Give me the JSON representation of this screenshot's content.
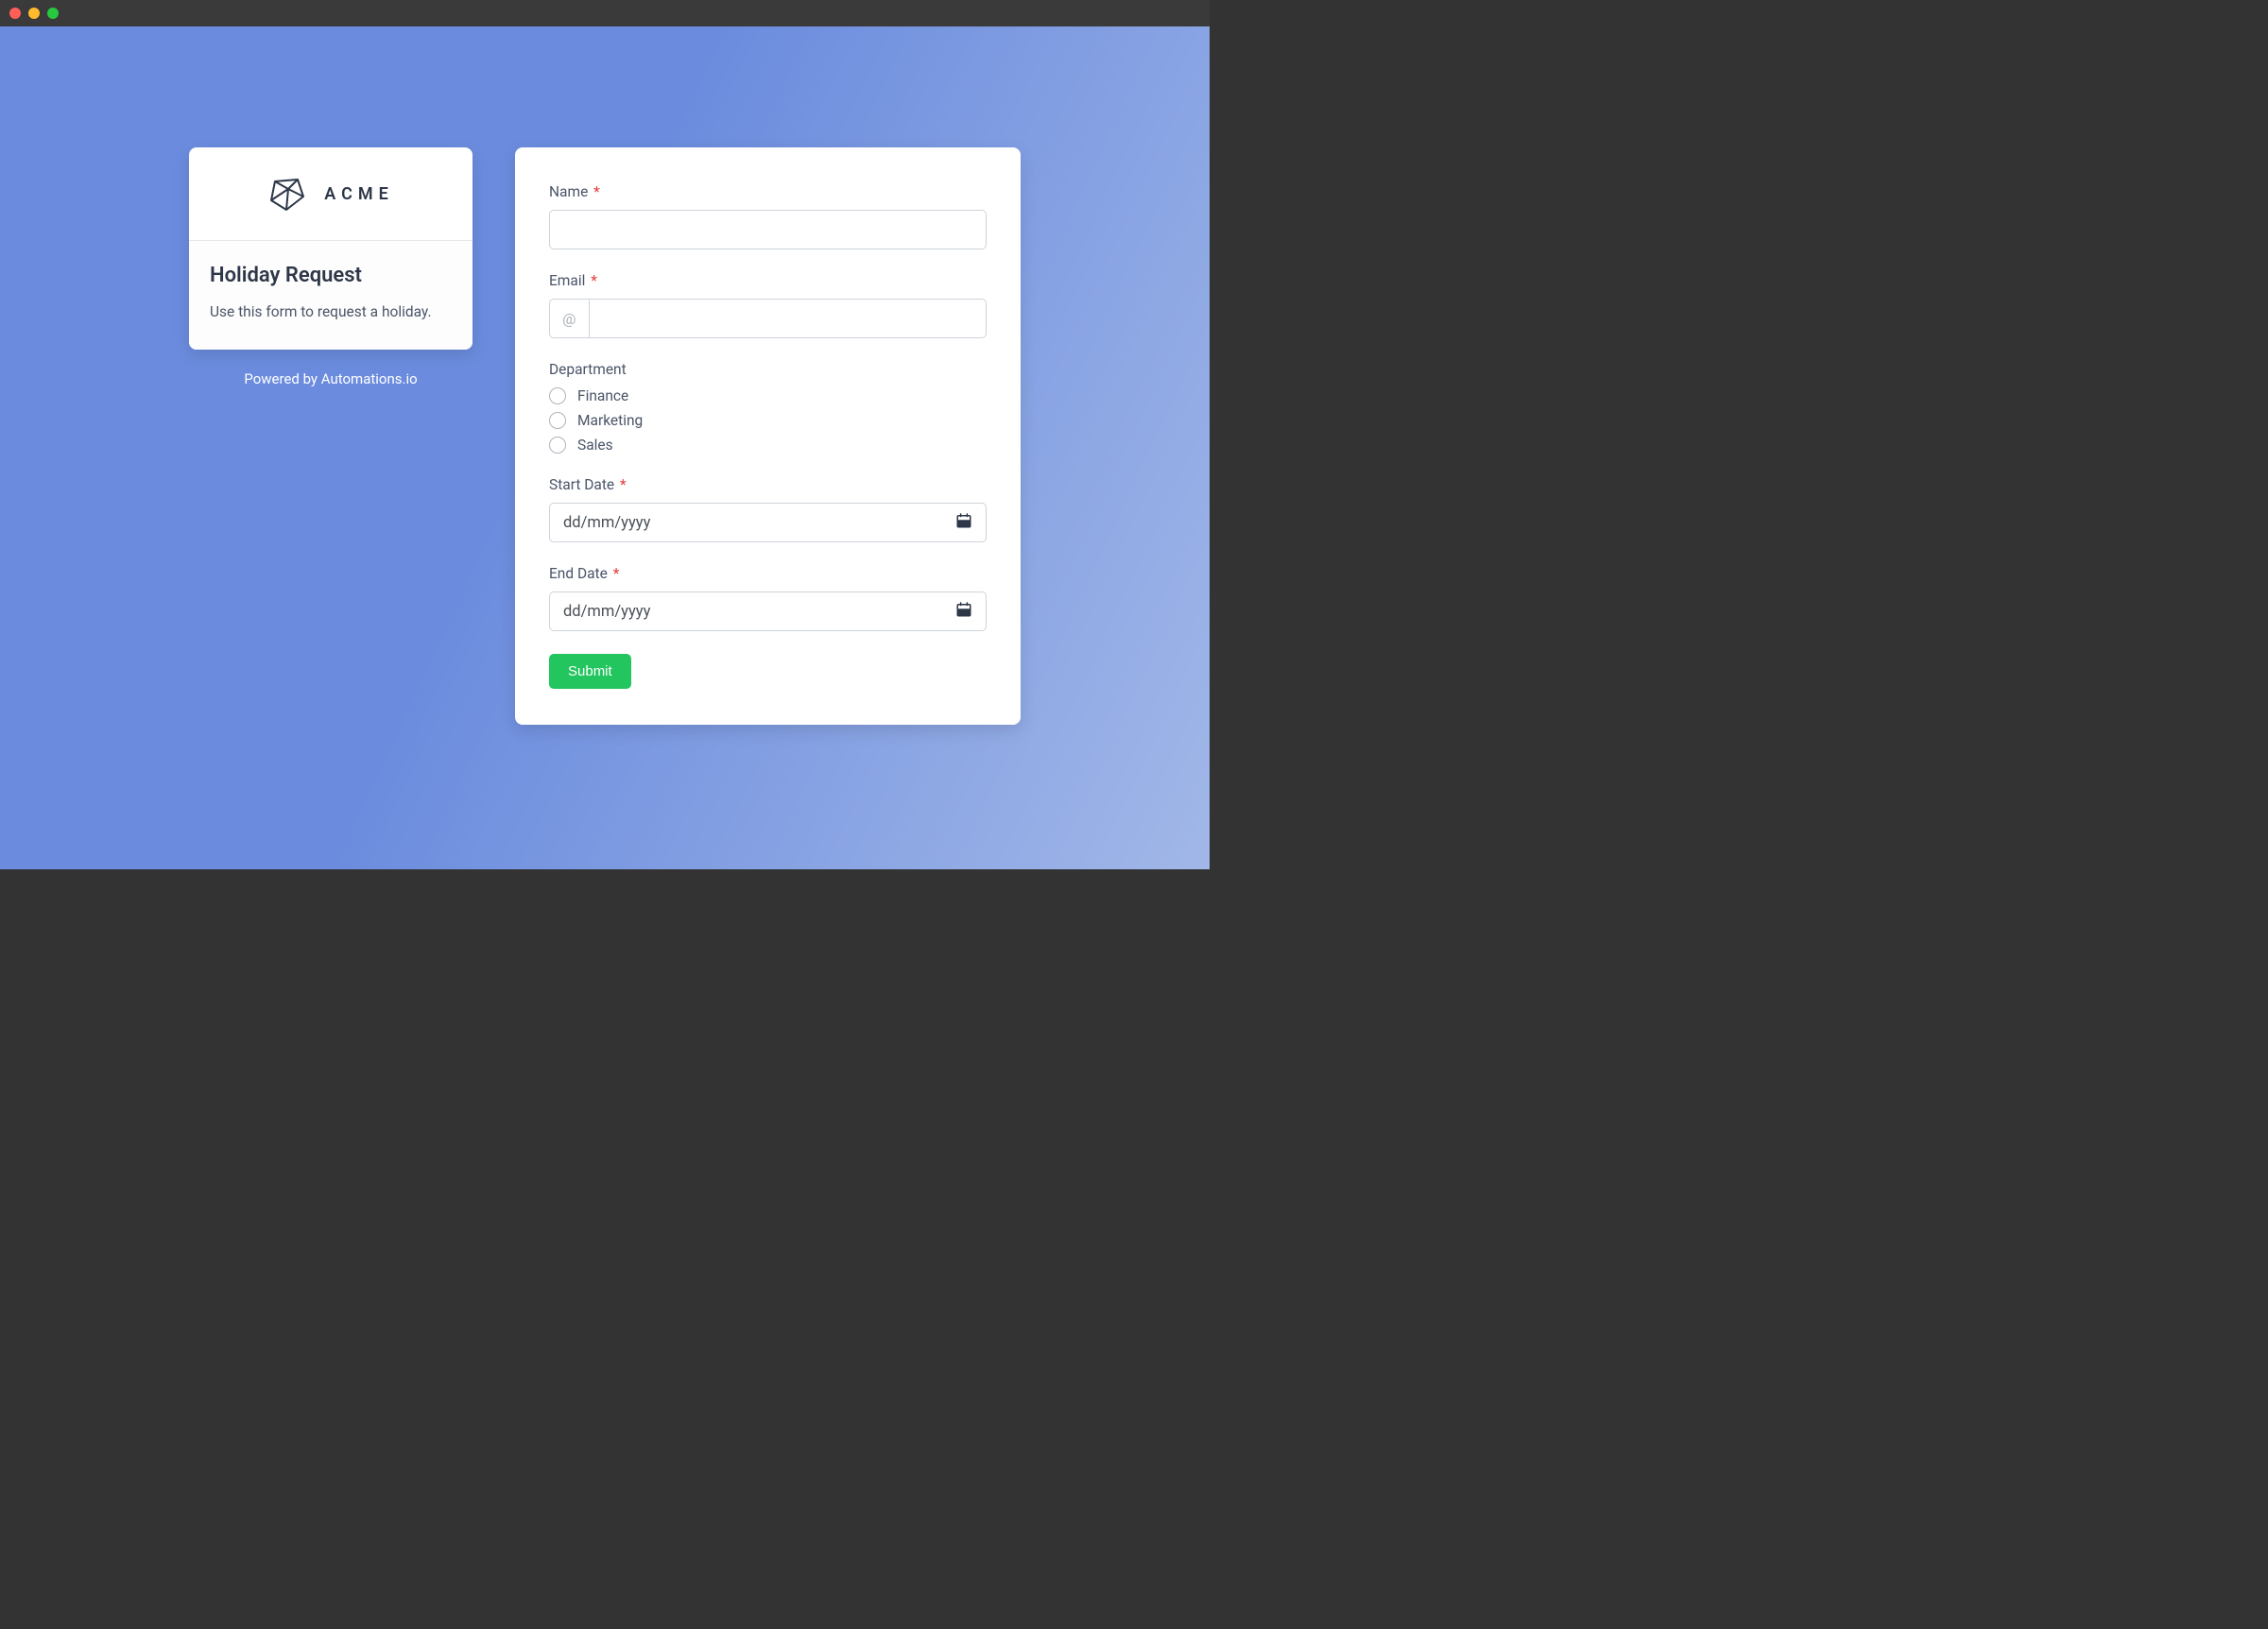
{
  "logo": {
    "text": "ACME"
  },
  "info": {
    "title": "Holiday Request",
    "description": "Use this form to request a holiday."
  },
  "footer": {
    "powered_by": "Powered by Automations.io"
  },
  "form": {
    "name": {
      "label": "Name",
      "required_marker": "*",
      "value": ""
    },
    "email": {
      "label": "Email",
      "required_marker": "*",
      "prefix": "@",
      "value": ""
    },
    "department": {
      "label": "Department",
      "options": [
        "Finance",
        "Marketing",
        "Sales"
      ]
    },
    "start_date": {
      "label": "Start Date",
      "required_marker": "*",
      "placeholder": "dd/mm/yyyy"
    },
    "end_date": {
      "label": "End Date",
      "required_marker": "*",
      "placeholder": "dd/mm/yyyy"
    },
    "submit_label": "Submit"
  }
}
